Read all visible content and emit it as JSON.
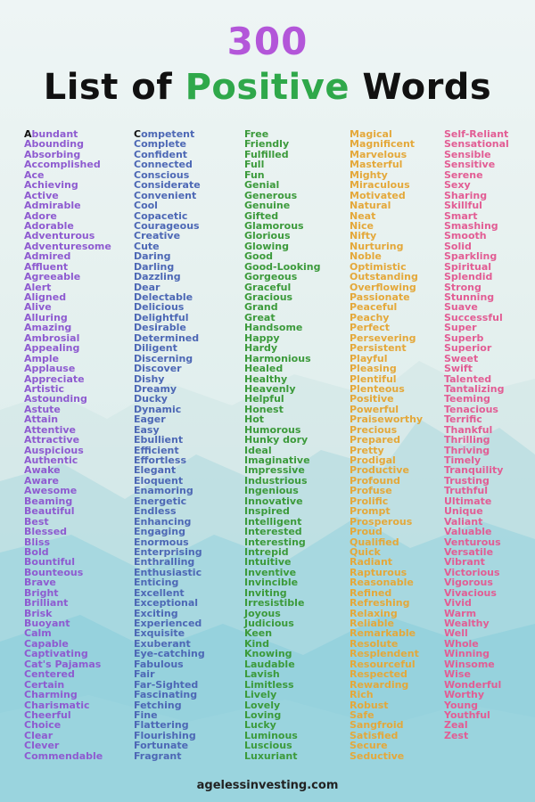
{
  "header": {
    "count": "300",
    "title_pre": "List of ",
    "title_accent": "Positive",
    "title_post": " Words"
  },
  "footer": {
    "site": "agelessinvesting.com"
  },
  "colors": {
    "count": "#b356d9",
    "accent": "#2fa84a",
    "col1": "#8e5bd0",
    "col2": "#4d68b5",
    "col3": "#3c9a3b",
    "col4": "#e4a83a",
    "col5": "#e25d94"
  },
  "columns": [
    [
      "Abundant",
      "Abounding",
      "Absorbing",
      "Accomplished",
      "Ace",
      "Achieving",
      "Active",
      "Admirable",
      "Adore",
      "Adorable",
      "Adventurous",
      "Adventuresome",
      "Admired",
      "Affluent",
      "Agreeable",
      "Alert",
      "Aligned",
      "Alive",
      "Alluring",
      "Amazing",
      "Ambrosial",
      "Appealing",
      "Ample",
      "Applause",
      "Appreciate",
      "Artistic",
      "Astounding",
      "Astute",
      "Attain",
      "Attentive",
      "Attractive",
      "Auspicious",
      "Authentic",
      "Awake",
      "Aware",
      "Awesome",
      "Beaming",
      "Beautiful",
      "Best",
      "Blessed",
      "Bliss",
      "Bold",
      "Bountiful",
      "Bounteous",
      "Brave",
      "Bright",
      "Brilliant",
      "Brisk",
      "Buoyant",
      "Calm",
      "Capable",
      "Captivating",
      "Cat's Pajamas",
      "Centered",
      "Certain",
      "Charming",
      "Charismatic",
      "Cheerful",
      "Choice",
      "Clear",
      "Clever",
      "Commendable"
    ],
    [
      "Competent",
      "Complete",
      "Confident",
      "Connected",
      "Conscious",
      "Considerate",
      "Convenient",
      "Cool",
      "Copacetic",
      "Courageous",
      "Creative",
      "Cute",
      "Daring",
      "Darling",
      "Dazzling",
      "Dear",
      "Delectable",
      "Delicious",
      "Delightful",
      "Desirable",
      "Determined",
      "Diligent",
      "Discerning",
      "Discover",
      "Dishy",
      "Dreamy",
      "Ducky",
      "Dynamic",
      "Eager",
      "Easy",
      "Ebullient",
      "Efficient",
      "Effortless",
      "Elegant",
      "Eloquent",
      "Enamoring",
      "Energetic",
      "Endless",
      "Enhancing",
      "Engaging",
      "Enormous",
      "Enterprising",
      "Enthralling",
      "Enthusiastic",
      "Enticing",
      "Excellent",
      "Exceptional",
      "Exciting",
      "Experienced",
      "Exquisite",
      "Exuberant",
      "Eye-catching",
      "Fabulous",
      "Fair",
      "Far-Sighted",
      "Fascinating",
      "Fetching",
      "Fine",
      "Flattering",
      "Flourishing",
      "Fortunate",
      "Fragrant"
    ],
    [
      "Free",
      "Friendly",
      "Fulfilled",
      "Full",
      "Fun",
      "Genial",
      "Generous",
      "Genuine",
      "Gifted",
      "Glamorous",
      "Glorious",
      "Glowing",
      "Good",
      "Good-Looking",
      "Gorgeous",
      "Graceful",
      "Gracious",
      "Grand",
      "Great",
      "Handsome",
      "Happy",
      "Hardy",
      "Harmonious",
      "Healed",
      "Healthy",
      "Heavenly",
      "Helpful",
      "Honest",
      "Hot",
      "Humorous",
      "Hunky dory",
      "Ideal",
      "Imaginative",
      "Impressive",
      "Industrious",
      "Ingenious",
      "Innovative",
      "Inspired",
      "Intelligent",
      "Interested",
      "Interesting",
      "Intrepid",
      "Intuitive",
      "Inventive",
      "Invincible",
      "Inviting",
      "Irresistible",
      "Joyous",
      "Judicious",
      "Keen",
      "Kind",
      "Knowing",
      "Laudable",
      "Lavish",
      "Limitless",
      "Lively",
      "Lovely",
      "Loving",
      "Lucky",
      "Luminous",
      "Luscious",
      "Luxuriant"
    ],
    [
      "Magical",
      "Magnificent",
      "Marvelous",
      "Masterful",
      "Mighty",
      "Miraculous",
      "Motivated",
      "Natural",
      "Neat",
      "Nice",
      "Nifty",
      "Nurturing",
      "Noble",
      "Optimistic",
      "Outstanding",
      "Overflowing",
      "Passionate",
      "Peaceful",
      "Peachy",
      "Perfect",
      "Persevering",
      "Persistent",
      "Playful",
      "Pleasing",
      "Plentiful",
      "Plenteous",
      "Positive",
      "Powerful",
      "Praiseworthy",
      "Precious",
      "Prepared",
      "Pretty",
      "Prodigal",
      "Productive",
      "Profound",
      "Profuse",
      "Prolific",
      "Prompt",
      "Prosperous",
      "Proud",
      "Qualified",
      "Quick",
      "Radiant",
      "Rapturous",
      "Reasonable",
      "Refined",
      "Refreshing",
      "Relaxing",
      "Reliable",
      "Remarkable",
      "Resolute",
      "Resplendent",
      "Resourceful",
      "Respected",
      "Rewarding",
      "Rich",
      "Robust",
      "Safe",
      "Sangfroid",
      "Satisfied",
      "Secure",
      "Seductive"
    ],
    [
      "Self-Reliant",
      "Sensational",
      "Sensible",
      "Sensitive",
      "Serene",
      "Sexy",
      "Sharing",
      "Skillful",
      "Smart",
      "Smashing",
      "Smooth",
      "Solid",
      "Sparkling",
      "Spiritual",
      "Splendid",
      "Strong",
      "Stunning",
      "Suave",
      "Successful",
      "Super",
      "Superb",
      "Superior",
      "Sweet",
      "Swift",
      "Talented",
      "Tantalizing",
      "Teeming",
      "Tenacious",
      "Terrific",
      "Thankful",
      "Thrilling",
      "Thriving",
      "Timely",
      "Tranquility",
      "Trusting",
      "Truthful",
      "Ultimate",
      "Unique",
      "Valiant",
      "Valuable",
      "Venturous",
      "Versatile",
      "Vibrant",
      "Victorious",
      "Vigorous",
      "Vivacious",
      "Vivid",
      "Warm",
      "Wealthy",
      "Well",
      "Whole",
      "Winning",
      "Winsome",
      "Wise",
      "Wonderful",
      "Worthy",
      "Young",
      "Youthful",
      "Zeal",
      "Zest"
    ]
  ]
}
